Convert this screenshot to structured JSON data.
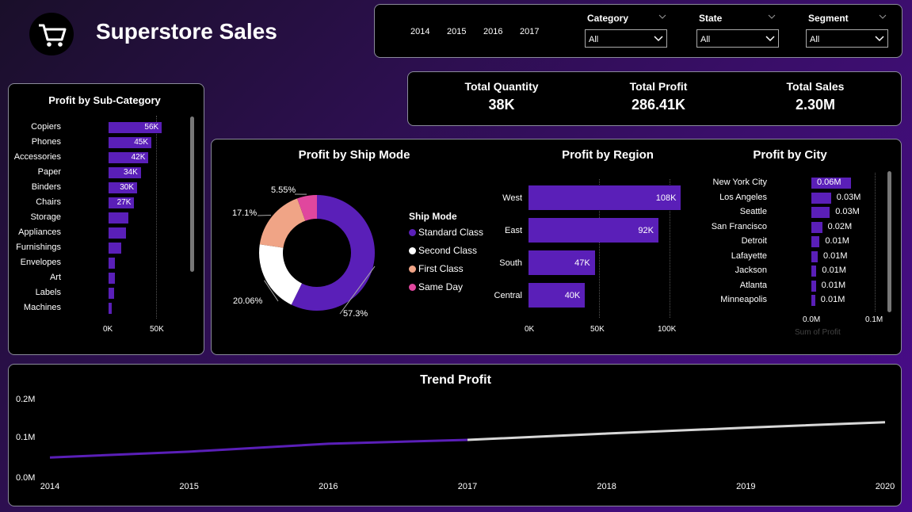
{
  "header": {
    "title": "Superstore Sales",
    "logo_icon": "shopping-cart-icon"
  },
  "filters": {
    "years": [
      "2014",
      "2015",
      "2016",
      "2017"
    ],
    "category": {
      "label": "Category",
      "value": "All"
    },
    "state": {
      "label": "State",
      "value": "All"
    },
    "segment": {
      "label": "Segment",
      "value": "All"
    }
  },
  "kpis": [
    {
      "label": "Total Quantity",
      "value": "38K"
    },
    {
      "label": "Total Profit",
      "value": "286.41K"
    },
    {
      "label": "Total Sales",
      "value": "2.30M"
    }
  ],
  "colors": {
    "accent": "#5a1fb8",
    "second": "#ffffff",
    "first": "#f0a486",
    "same_day": "#e0479e",
    "trend_future": "#d8d8d8"
  },
  "subcategory": {
    "title": "Profit by Sub-Category",
    "ticks": [
      "0K",
      "50K"
    ],
    "labels": [
      "56K",
      "45K",
      "42K",
      "34K",
      "30K",
      "27K"
    ]
  },
  "shipmode": {
    "title": "Profit by Ship Mode",
    "legend_title": "Ship Mode",
    "legend": [
      "Standard Class",
      "Second Class",
      "First Class",
      "Same Day"
    ],
    "labels": [
      "57.3%",
      "20.06%",
      "17.1%",
      "5.55%"
    ]
  },
  "region": {
    "title": "Profit by Region",
    "ticks": [
      "0K",
      "50K",
      "100K"
    ],
    "labels": [
      "108K",
      "92K",
      "47K",
      "40K"
    ]
  },
  "city": {
    "title": "Profit by City",
    "ticks": [
      "0.0M",
      "0.1M"
    ],
    "axis_title": "Sum of Profit",
    "labels": [
      "0.06M",
      "0.03M",
      "0.03M",
      "0.02M",
      "0.01M",
      "0.01M",
      "0.01M",
      "0.01M",
      "0.01M"
    ]
  },
  "trend": {
    "title": "Trend Profit",
    "yticks": [
      "0.2M",
      "0.1M",
      "0.0M"
    ]
  },
  "chart_data": [
    {
      "type": "bar",
      "title": "Profit by Sub-Category",
      "categories": [
        "Copiers",
        "Phones",
        "Accessories",
        "Paper",
        "Binders",
        "Chairs",
        "Storage",
        "Appliances",
        "Furnishings",
        "Envelopes",
        "Art",
        "Labels",
        "Machines"
      ],
      "values": [
        56,
        45,
        42,
        34,
        30,
        27,
        21,
        18,
        13,
        7,
        6.5,
        5.5,
        3.4
      ],
      "xlim": [
        0,
        65
      ]
    },
    {
      "type": "pie",
      "title": "Profit by Ship Mode",
      "categories": [
        "Standard Class",
        "Second Class",
        "First Class",
        "Same Day"
      ],
      "values": [
        57.3,
        20.06,
        17.1,
        5.55
      ]
    },
    {
      "type": "bar",
      "title": "Profit by Region",
      "categories": [
        "West",
        "East",
        "South",
        "Central"
      ],
      "values": [
        108,
        92,
        47,
        40
      ],
      "xlim": [
        0,
        110
      ]
    },
    {
      "type": "bar",
      "title": "Profit by City",
      "categories": [
        "New York City",
        "Los Angeles",
        "Seattle",
        "San Francisco",
        "Detroit",
        "Lafayette",
        "Jackson",
        "Atlanta",
        "Minneapolis"
      ],
      "values": [
        0.062,
        0.031,
        0.029,
        0.017,
        0.013,
        0.01,
        0.008,
        0.007,
        0.006
      ],
      "xlim": [
        0,
        0.1
      ]
    },
    {
      "type": "line",
      "title": "Trend Profit",
      "x": [
        "2014",
        "2015",
        "2016",
        "2017",
        "2018",
        "2019",
        "2020"
      ],
      "series": [
        {
          "values": [
            0.05,
            0.065,
            0.085,
            0.095
          ]
        },
        {
          "values": [
            null,
            null,
            null,
            0.095,
            0.111,
            0.126,
            0.14
          ]
        }
      ],
      "ylim": [
        0,
        0.2
      ]
    }
  ]
}
